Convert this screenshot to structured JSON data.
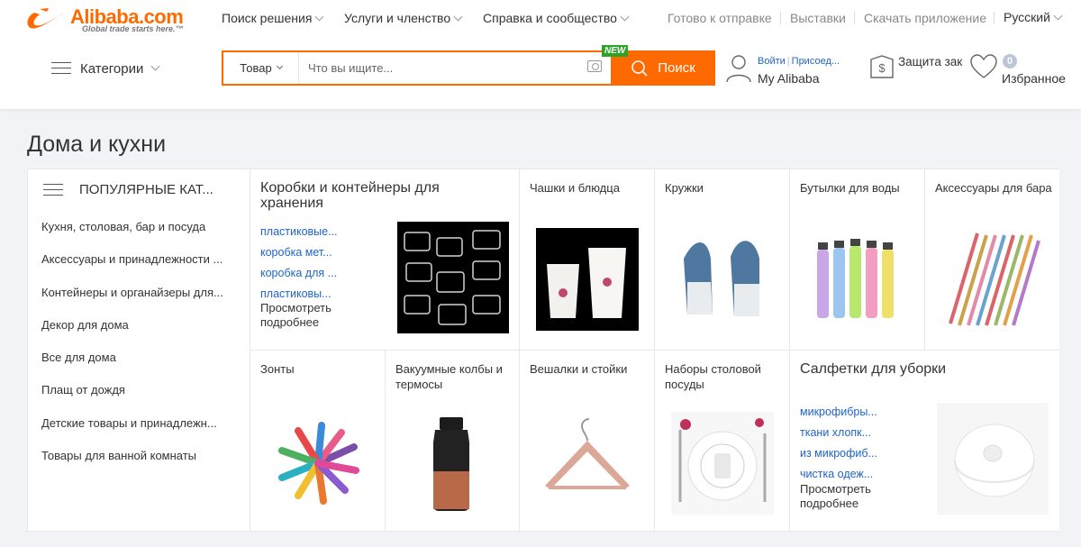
{
  "header": {
    "logo": {
      "word": "Alibaba.com",
      "tagline": "Global trade starts here.™",
      "brand_color": "#ff6a00"
    },
    "nav": [
      {
        "label": "Поиск решения"
      },
      {
        "label": "Услуги и членство"
      },
      {
        "label": "Справка и сообщество"
      }
    ],
    "links": [
      "Готово к отправке",
      "Выставки",
      "Скачать приложение"
    ],
    "language": "Русский",
    "categories_label": "Категории",
    "search": {
      "type": "Товар",
      "placeholder": "Что вы ищите...",
      "button": "Поиск",
      "new_badge": "NEW"
    },
    "user": {
      "signin": "Войти",
      "join": "Присоед...",
      "account": "My Alibaba"
    },
    "protection": "Защита зак",
    "favorites": {
      "count": "0",
      "label": "Избранное"
    }
  },
  "section": {
    "title": "Дома и кухни",
    "popular_heading": "ПОПУЛЯРНЫЕ КАТ...",
    "categories": [
      "Кухня, столовая, бар и посуда",
      "Аксессуары и принадлежности ...",
      "Контейнеры и органайзеры для...",
      "Декор для дома",
      "Все для дома",
      "Плащ от дождя",
      "Детские товары и принадлежн...",
      "Товары для ванной комнаты"
    ],
    "featured_1": {
      "title": "Коробки и контейнеры для хранения",
      "links": [
        "пластиковые...",
        "коробка мет...",
        "коробка для ...",
        "пластиковы..."
      ],
      "more": "Просмотреть подробнее"
    },
    "featured_2": {
      "title": "Салфетки для уборки",
      "links": [
        "микрофибры...",
        "ткани хлопк...",
        "из микрофиб...",
        "чистка одеж..."
      ],
      "more": "Просмотреть подробнее"
    },
    "tiles": {
      "cups": "Чашки и блюдца",
      "mugs": "Кружки",
      "bottles": "Бутылки для воды",
      "bar": "Аксессуары для бара",
      "umbrellas": "Зонты",
      "flasks": "Вакуумные колбы и термосы",
      "hangers": "Вешалки и стойки",
      "tableware": "Наборы столовой посуды"
    }
  },
  "colors": {
    "accent": "#ff6a00",
    "link": "#1e64c8",
    "page_bg": "#f2f3f7",
    "new_badge": "#2aa52a"
  }
}
